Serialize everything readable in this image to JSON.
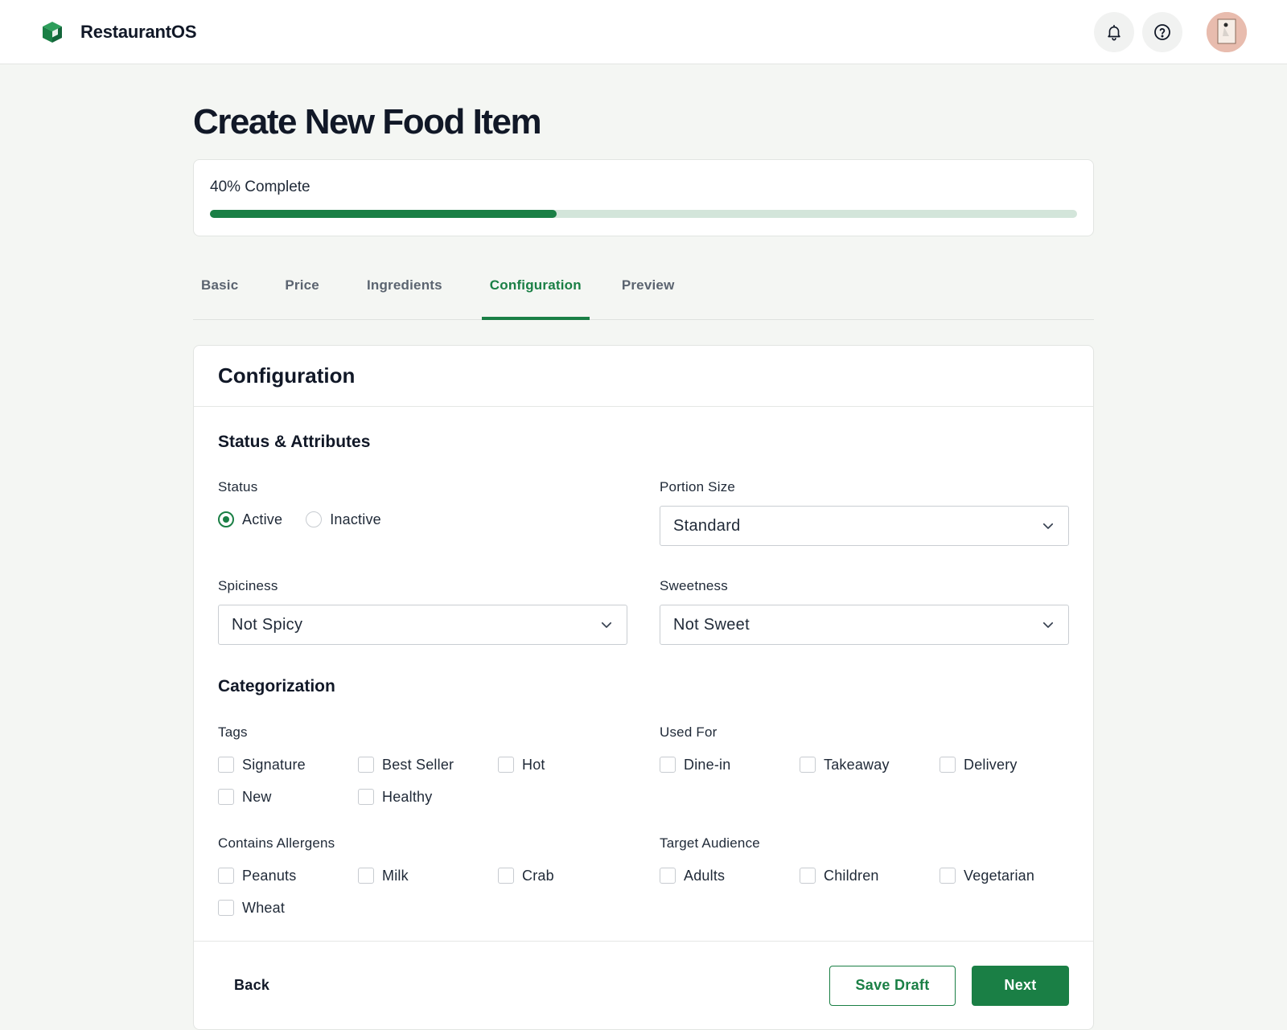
{
  "colors": {
    "accent": "#1a7f45",
    "progress_track": "#d3e5da",
    "page_background": "#f4f6f3"
  },
  "header": {
    "app_name": "RestaurantOS",
    "logo_icon": "cube-icon",
    "notification_icon": "bell-icon",
    "help_icon": "help-circle-icon",
    "avatar_icon": "user-avatar"
  },
  "page": {
    "title": "Create New Food Item"
  },
  "progress": {
    "label": "40% Complete",
    "fraction": 0.4
  },
  "tabs": [
    {
      "label": "Basic",
      "active": false
    },
    {
      "label": "Price",
      "active": false
    },
    {
      "label": "Ingredients",
      "active": false
    },
    {
      "label": "Configuration",
      "active": true
    },
    {
      "label": "Preview",
      "active": false
    }
  ],
  "form": {
    "card_title": "Configuration",
    "status_section": {
      "title": "Status & Attributes",
      "status": {
        "label": "Status",
        "options": [
          {
            "label": "Active",
            "checked": true
          },
          {
            "label": "Inactive",
            "checked": false
          }
        ]
      },
      "portion_size": {
        "label": "Portion Size",
        "value": "Standard"
      },
      "spiciness": {
        "label": "Spiciness",
        "value": "Not Spicy"
      },
      "sweetness": {
        "label": "Sweetness",
        "value": "Not Sweet"
      }
    },
    "categorization": {
      "title": "Categorization",
      "tags": {
        "label": "Tags",
        "options": [
          "Signature",
          "Best Seller",
          "Hot",
          "New",
          "Healthy"
        ]
      },
      "used_for": {
        "label": "Used For",
        "options": [
          "Dine-in",
          "Takeaway",
          "Delivery"
        ]
      },
      "allergens": {
        "label": "Contains Allergens",
        "options": [
          "Peanuts",
          "Milk",
          "Crab",
          "Wheat"
        ]
      },
      "audience": {
        "label": "Target Audience",
        "options": [
          "Adults",
          "Children",
          "Vegetarian"
        ]
      }
    }
  },
  "footer": {
    "back_label": "Back",
    "save_draft_label": "Save Draft",
    "next_label": "Next"
  }
}
